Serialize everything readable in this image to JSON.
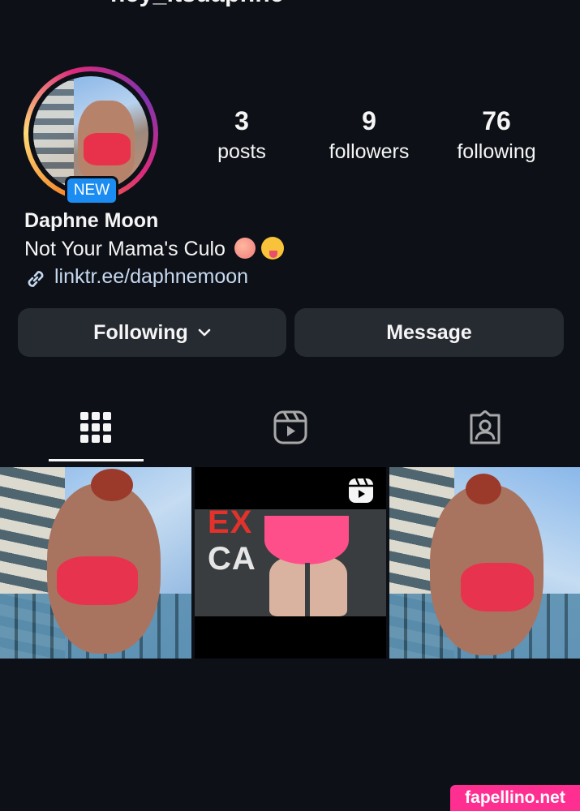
{
  "header": {
    "username": "hey_itsdaphne",
    "back_icon": "back-arrow-icon",
    "bell_icon": "bell-icon",
    "more_icon": "more-vertical-icon"
  },
  "profile": {
    "badge": "NEW",
    "display_name": "Daphne Moon",
    "bio": "Not Your Mama's Culo",
    "bio_emojis": [
      "peach",
      "winking-face-with-tongue"
    ],
    "link": "linktr.ee/daphnemoon"
  },
  "stats": [
    {
      "value": "3",
      "label": "posts"
    },
    {
      "value": "9",
      "label": "followers"
    },
    {
      "value": "76",
      "label": "following"
    }
  ],
  "actions": {
    "following_label": "Following",
    "message_label": "Message"
  },
  "tabs": [
    {
      "icon": "grid-icon",
      "selected": true
    },
    {
      "icon": "reels-icon",
      "selected": false
    },
    {
      "icon": "tagged-icon",
      "selected": false
    }
  ],
  "posts": [
    {
      "kind": "photo"
    },
    {
      "kind": "reel",
      "banner_text_left": "EX",
      "banner_text_right": "CA"
    },
    {
      "kind": "photo"
    }
  ],
  "watermark": "fapellino.net",
  "colors": {
    "background": "#0d1117",
    "button": "#262a31",
    "badge": "#1b8cf2",
    "link": "#c6d8f0",
    "watermark": "#ff2f91"
  }
}
